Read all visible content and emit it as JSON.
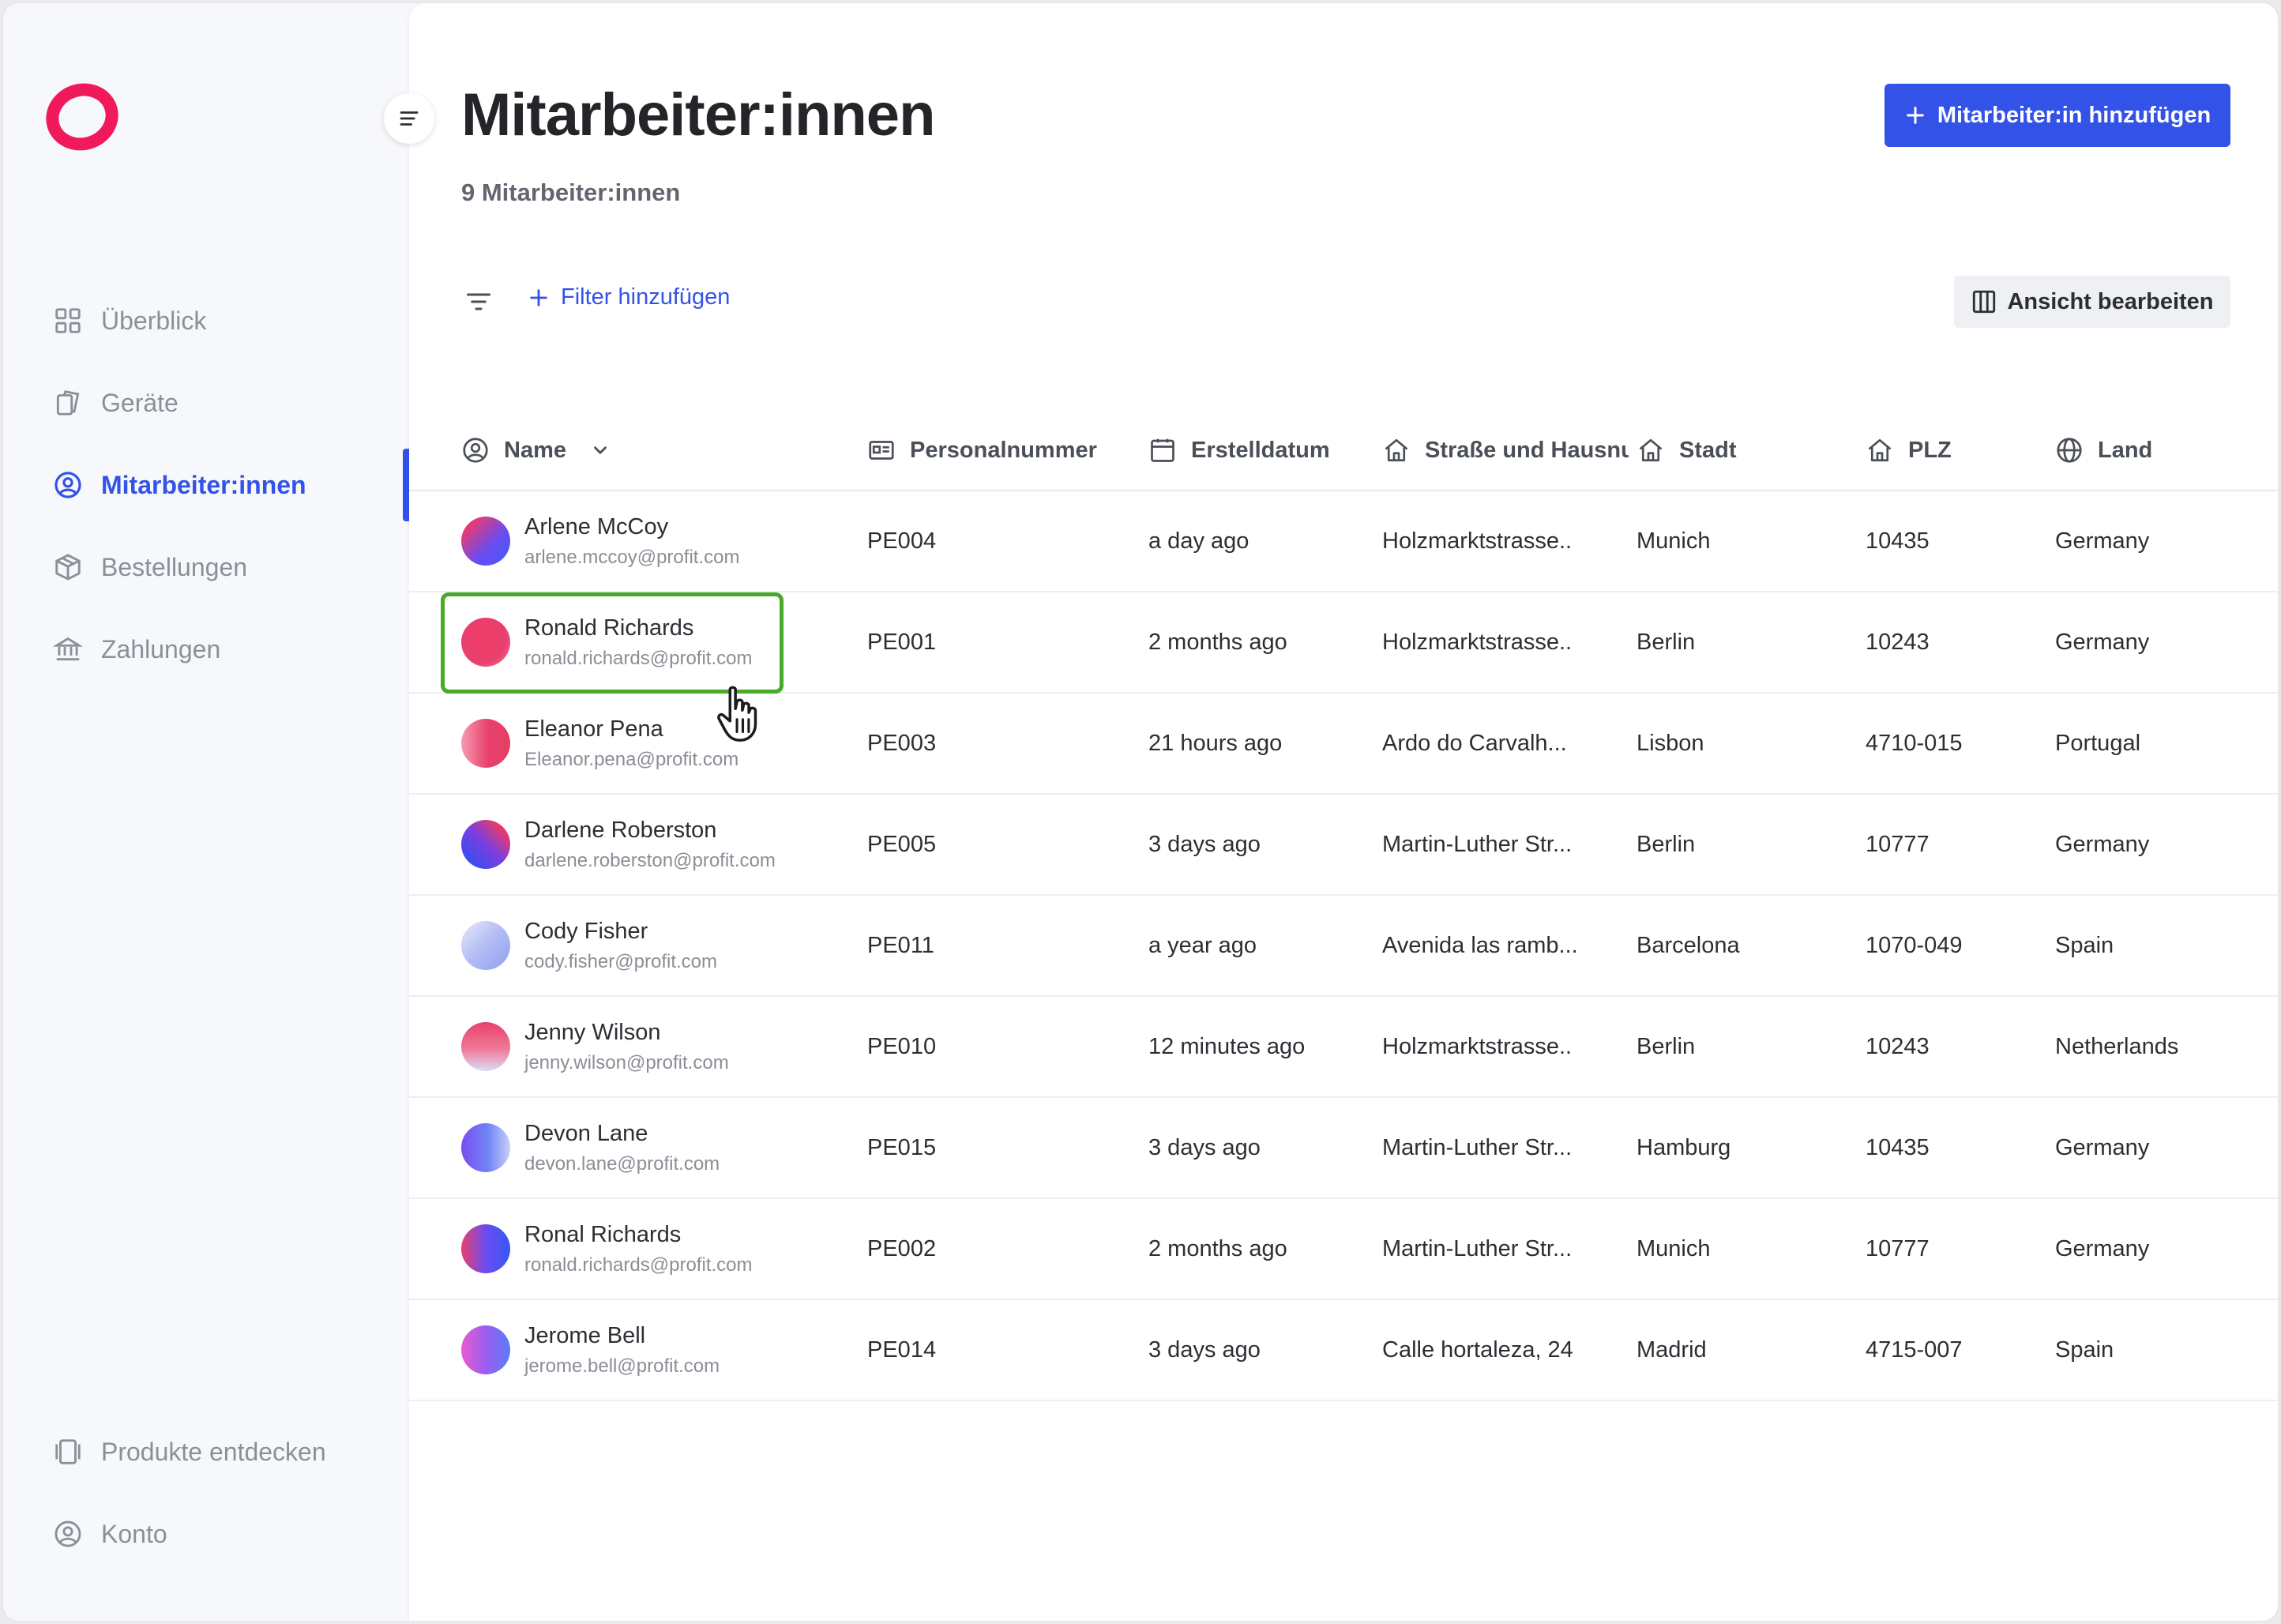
{
  "sidebar": {
    "items": [
      {
        "label": "Überblick",
        "icon": "grid-icon"
      },
      {
        "label": "Geräte",
        "icon": "devices-icon"
      },
      {
        "label": "Mitarbeiter:innen",
        "icon": "user-circle-icon",
        "active": true
      },
      {
        "label": "Bestellungen",
        "icon": "package-icon"
      },
      {
        "label": "Zahlungen",
        "icon": "bank-icon"
      }
    ],
    "bottom": [
      {
        "label": "Produkte entdecken",
        "icon": "products-icon"
      },
      {
        "label": "Konto",
        "icon": "account-icon"
      }
    ]
  },
  "header": {
    "title": "Mitarbeiter:innen",
    "count": "9 Mitarbeiter:innen",
    "add_button": "Mitarbeiter:in hinzufügen"
  },
  "toolbar": {
    "filter_add": "Filter hinzufügen",
    "edit_view": "Ansicht bearbeiten"
  },
  "table": {
    "columns": [
      "Name",
      "Personalnummer",
      "Erstelldatum",
      "Straße und Hausnummer",
      "Stadt",
      "PLZ",
      "Land"
    ],
    "rows": [
      {
        "name": "Arlene McCoy",
        "email": "arlene.mccoy@profit.com",
        "id": "PE004",
        "created": "a day ago",
        "street": "Holzmarktstrasse..",
        "city": "Munich",
        "plz": "10435",
        "country": "Germany"
      },
      {
        "name": "Ronald Richards",
        "email": "ronald.richards@profit.com",
        "id": "PE001",
        "created": "2 months ago",
        "street": "Holzmarktstrasse..",
        "city": "Berlin",
        "plz": "10243",
        "country": "Germany"
      },
      {
        "name": "Eleanor Pena",
        "email": "Eleanor.pena@profit.com",
        "id": "PE003",
        "created": "21 hours ago",
        "street": "Ardo do Carvalh...",
        "city": "Lisbon",
        "plz": "4710-015",
        "country": "Portugal"
      },
      {
        "name": "Darlene Roberston",
        "email": "darlene.roberston@profit.com",
        "id": "PE005",
        "created": "3 days ago",
        "street": "Martin-Luther Str...",
        "city": "Berlin",
        "plz": "10777",
        "country": "Germany"
      },
      {
        "name": "Cody Fisher",
        "email": "cody.fisher@profit.com",
        "id": "PE011",
        "created": "a year ago",
        "street": "Avenida las ramb...",
        "city": "Barcelona",
        "plz": "1070-049",
        "country": "Spain"
      },
      {
        "name": "Jenny Wilson",
        "email": "jenny.wilson@profit.com",
        "id": "PE010",
        "created": "12 minutes ago",
        "street": "Holzmarktstrasse..",
        "city": "Berlin",
        "plz": "10243",
        "country": "Netherlands"
      },
      {
        "name": "Devon Lane",
        "email": "devon.lane@profit.com",
        "id": "PE015",
        "created": "3 days ago",
        "street": "Martin-Luther Str...",
        "city": "Hamburg",
        "plz": "10435",
        "country": "Germany"
      },
      {
        "name": "Ronal Richards",
        "email": "ronald.richards@profit.com",
        "id": "PE002",
        "created": "2 months ago",
        "street": "Martin-Luther Str...",
        "city": "Munich",
        "plz": "10777",
        "country": "Germany"
      },
      {
        "name": "Jerome Bell",
        "email": "jerome.bell@profit.com",
        "id": "PE014",
        "created": "3 days ago",
        "street": "Calle hortaleza, 24",
        "city": "Madrid",
        "plz": "4715-007",
        "country": "Spain"
      }
    ]
  },
  "colors": {
    "accent": "#3352e8",
    "brand": "#f0195a",
    "highlight": "#4aa928"
  }
}
